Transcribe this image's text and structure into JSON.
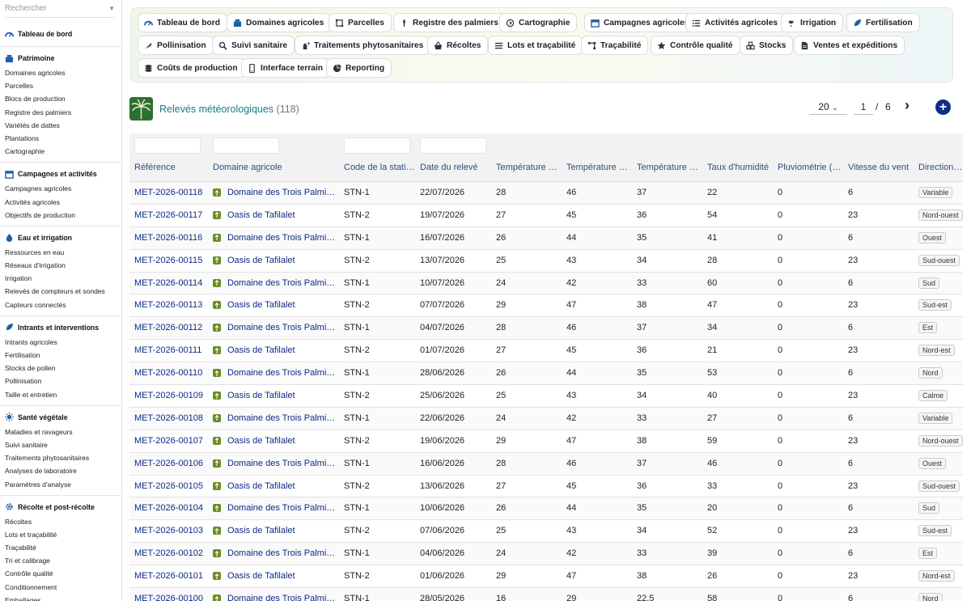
{
  "sidebar": {
    "search_placeholder": "Rechercher",
    "groups": [
      {
        "title": "Tableau de bord",
        "icon": "dashboard-icon",
        "items": []
      },
      {
        "title": "Patrimoine",
        "icon": "building-icon",
        "items": [
          "Domaines agricoles",
          "Parcelles",
          "Blocs de production",
          "Registre des palmiers",
          "Variétés de dattes",
          "Plantations",
          "Cartographie"
        ]
      },
      {
        "title": "Campagnes et activités",
        "icon": "calendar-icon",
        "items": [
          "Campagnes agricoles",
          "Activités agricoles",
          "Objectifs de production"
        ]
      },
      {
        "title": "Eau et irrigation",
        "icon": "water-drop-icon",
        "items": [
          "Ressources en eau",
          "Réseaux d'irrigation",
          "Irrigation",
          "Relevés de compteurs et sondes",
          "Capteurs connectés"
        ]
      },
      {
        "title": "Intrants et interventions",
        "icon": "leaf-icon",
        "items": [
          "Intrants agricoles",
          "Fertilisation",
          "Stocks de pollen",
          "Pollinisation",
          "Taille et entretien"
        ]
      },
      {
        "title": "Santé végétale",
        "icon": "virus-icon",
        "items": [
          "Maladies et ravageurs",
          "Suivi sanitaire",
          "Traitements phytosanitaires",
          "Analyses de laboratoire",
          "Paramètres d'analyse"
        ]
      },
      {
        "title": "Récolte et post-récolte",
        "icon": "gear-icon",
        "items": [
          "Récoltes",
          "Lots et traçabilité",
          "Traçabilité",
          "Tri et calibrage",
          "Contrôle qualité",
          "Conditionnement",
          "Emballages"
        ]
      }
    ]
  },
  "topnav": [
    {
      "label": "Tableau de bord",
      "icon": "dashboard-icon"
    },
    {
      "label": "Domaines agricoles",
      "icon": "building-icon"
    },
    {
      "label": "Parcelles",
      "icon": "parcel-icon"
    },
    {
      "label": "Registre des palmiers",
      "icon": "palm-icon"
    },
    {
      "label": "Cartographie",
      "icon": "globe-icon"
    },
    {
      "label": "Campagnes agricoles",
      "icon": "calendar-icon"
    },
    {
      "label": "Activités agricoles",
      "icon": "list-icon"
    },
    {
      "label": "Irrigation",
      "icon": "faucet-icon"
    },
    {
      "label": "Fertilisation",
      "icon": "leaf-icon"
    },
    {
      "label": "Pollinisation",
      "icon": "feather-icon"
    },
    {
      "label": "Suivi sanitaire",
      "icon": "magnifier-icon"
    },
    {
      "label": "Traitements phytosanitaires",
      "icon": "spray-icon"
    },
    {
      "label": "Récoltes",
      "icon": "basket-icon"
    },
    {
      "label": "Lots et traçabilité",
      "icon": "lines-icon"
    },
    {
      "label": "Traçabilité",
      "icon": "route-icon"
    },
    {
      "label": "Contrôle qualité",
      "icon": "star-icon"
    },
    {
      "label": "Stocks",
      "icon": "boxes-icon"
    },
    {
      "label": "Ventes et expéditions",
      "icon": "document-icon"
    },
    {
      "label": "Coûts de production",
      "icon": "coins-icon"
    },
    {
      "label": "Interface terrain",
      "icon": "phone-icon"
    },
    {
      "label": "Reporting",
      "icon": "pie-icon"
    }
  ],
  "page": {
    "title": "Relevés météorologiques",
    "count": "(118)"
  },
  "pager": {
    "page_size": "20",
    "current_page": "1",
    "separator": "/",
    "total_pages": "6",
    "next": "›",
    "add": "+"
  },
  "table": {
    "columns": [
      "Référence",
      "Domaine agricole",
      "Code de la station",
      "Date du relevé",
      "Température minimale",
      "Température maximale",
      "Température moyenne",
      "Taux d'humidité",
      "Pluviométrie (mm)",
      "Vitesse du vent",
      "Direction du vent"
    ],
    "rows": [
      [
        "MET-2026-00118",
        "Domaine des Trois Palmiers",
        "STN-1",
        "22/07/2026",
        "28",
        "46",
        "37",
        "22",
        "0",
        "6",
        "Variable"
      ],
      [
        "MET-2026-00117",
        "Oasis de Tafilalet",
        "STN-2",
        "19/07/2026",
        "27",
        "45",
        "36",
        "54",
        "0",
        "23",
        "Nord-ouest"
      ],
      [
        "MET-2026-00116",
        "Domaine des Trois Palmiers",
        "STN-1",
        "16/07/2026",
        "26",
        "44",
        "35",
        "41",
        "0",
        "6",
        "Ouest"
      ],
      [
        "MET-2026-00115",
        "Oasis de Tafilalet",
        "STN-2",
        "13/07/2026",
        "25",
        "43",
        "34",
        "28",
        "0",
        "23",
        "Sud-ouest"
      ],
      [
        "MET-2026-00114",
        "Domaine des Trois Palmiers",
        "STN-1",
        "10/07/2026",
        "24",
        "42",
        "33",
        "60",
        "0",
        "6",
        "Sud"
      ],
      [
        "MET-2026-00113",
        "Oasis de Tafilalet",
        "STN-2",
        "07/07/2026",
        "29",
        "47",
        "38",
        "47",
        "0",
        "23",
        "Sud-est"
      ],
      [
        "MET-2026-00112",
        "Domaine des Trois Palmiers",
        "STN-1",
        "04/07/2026",
        "28",
        "46",
        "37",
        "34",
        "0",
        "6",
        "Est"
      ],
      [
        "MET-2026-00111",
        "Oasis de Tafilalet",
        "STN-2",
        "01/07/2026",
        "27",
        "45",
        "36",
        "21",
        "0",
        "23",
        "Nord-est"
      ],
      [
        "MET-2026-00110",
        "Domaine des Trois Palmiers",
        "STN-1",
        "28/06/2026",
        "26",
        "44",
        "35",
        "53",
        "0",
        "6",
        "Nord"
      ],
      [
        "MET-2026-00109",
        "Oasis de Tafilalet",
        "STN-2",
        "25/06/2026",
        "25",
        "43",
        "34",
        "40",
        "0",
        "23",
        "Calme"
      ],
      [
        "MET-2026-00108",
        "Domaine des Trois Palmiers",
        "STN-1",
        "22/06/2026",
        "24",
        "42",
        "33",
        "27",
        "0",
        "6",
        "Variable"
      ],
      [
        "MET-2026-00107",
        "Oasis de Tafilalet",
        "STN-2",
        "19/06/2026",
        "29",
        "47",
        "38",
        "59",
        "0",
        "23",
        "Nord-ouest"
      ],
      [
        "MET-2026-00106",
        "Domaine des Trois Palmiers",
        "STN-1",
        "16/06/2026",
        "28",
        "46",
        "37",
        "46",
        "0",
        "6",
        "Ouest"
      ],
      [
        "MET-2026-00105",
        "Oasis de Tafilalet",
        "STN-2",
        "13/06/2026",
        "27",
        "45",
        "36",
        "33",
        "0",
        "23",
        "Sud-ouest"
      ],
      [
        "MET-2026-00104",
        "Domaine des Trois Palmiers",
        "STN-1",
        "10/06/2026",
        "26",
        "44",
        "35",
        "20",
        "0",
        "6",
        "Sud"
      ],
      [
        "MET-2026-00103",
        "Oasis de Tafilalet",
        "STN-2",
        "07/06/2026",
        "25",
        "43",
        "34",
        "52",
        "0",
        "23",
        "Sud-est"
      ],
      [
        "MET-2026-00102",
        "Domaine des Trois Palmiers",
        "STN-1",
        "04/06/2026",
        "24",
        "42",
        "33",
        "39",
        "0",
        "6",
        "Est"
      ],
      [
        "MET-2026-00101",
        "Oasis de Tafilalet",
        "STN-2",
        "01/06/2026",
        "29",
        "47",
        "38",
        "26",
        "0",
        "23",
        "Nord-est"
      ],
      [
        "MET-2026-00100",
        "Domaine des Trois Palmiers",
        "STN-1",
        "28/05/2026",
        "16",
        "29",
        "22.5",
        "58",
        "0",
        "6",
        "Nord"
      ]
    ]
  }
}
